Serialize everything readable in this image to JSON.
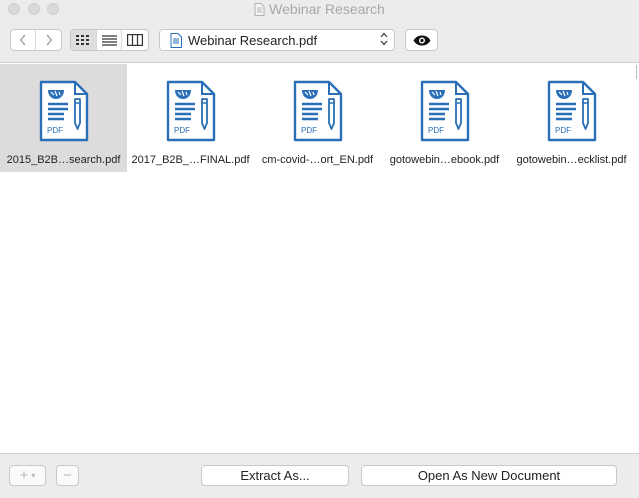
{
  "window": {
    "title": "Webinar Research"
  },
  "toolbar": {
    "nav_back_icon": "chevron-left-icon",
    "nav_forward_icon": "chevron-right-icon",
    "view_modes": [
      "icon-view",
      "list-view",
      "column-view"
    ],
    "active_view": "icon-view",
    "document_select": "Webinar Research.pdf",
    "preview_icon": "eye-icon"
  },
  "files": [
    {
      "name": "2015_B2B…search.pdf",
      "selected": true
    },
    {
      "name": "2017_B2B_…FINAL.pdf",
      "selected": false
    },
    {
      "name": "cm-covid-…ort_EN.pdf",
      "selected": false
    },
    {
      "name": "gotowebin…ebook.pdf",
      "selected": false
    },
    {
      "name": "gotowebin…ecklist.pdf",
      "selected": false
    }
  ],
  "bottombar": {
    "add_label": "+",
    "remove_label": "−",
    "extract_label": "Extract As...",
    "open_label": "Open As New Document"
  },
  "colors": {
    "accent_blue": "#2a6fb8",
    "chrome_gray": "#ececec",
    "selection_gray": "#dcdcdc"
  }
}
